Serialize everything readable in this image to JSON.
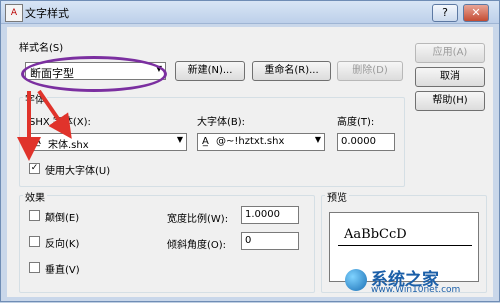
{
  "window": {
    "title": "文字样式",
    "help_btn": "?",
    "close_btn": "✕"
  },
  "style_name": {
    "label": "样式名(S)",
    "value": "断面字型",
    "new_btn": "新建(N)...",
    "rename_btn": "重命名(R)...",
    "delete_btn": "删除(D)"
  },
  "side_buttons": {
    "apply": "应用(A)",
    "cancel": "取消",
    "help": "帮助(H)"
  },
  "font": {
    "group_label": "字体",
    "shx_label": "SHX 字体(X):",
    "shx_value": "宋体.shx",
    "big_label": "大字体(B):",
    "big_value": "@~!hztxt.shx",
    "height_label": "高度(T):",
    "height_value": "0.0000",
    "use_bigfont_label": "使用大字体(U)",
    "use_bigfont_checked": "✓"
  },
  "effects": {
    "group_label": "效果",
    "upside_down": "颠倒(E)",
    "backwards": "反向(K)",
    "vertical": "垂直(V)",
    "width_factor_label": "宽度比例(W):",
    "width_factor_value": "1.0000",
    "oblique_label": "倾斜角度(O):",
    "oblique_value": "0"
  },
  "preview": {
    "group_label": "预览",
    "sample": "AaBbCcD"
  },
  "watermark": {
    "text": "系统之家",
    "url": "www.Win10net.com"
  },
  "colors": {
    "highlight": "#7b2fa0",
    "arrow": "#e0332b",
    "window_frame": "#c9d7ea",
    "client": "#f0f0f0"
  }
}
